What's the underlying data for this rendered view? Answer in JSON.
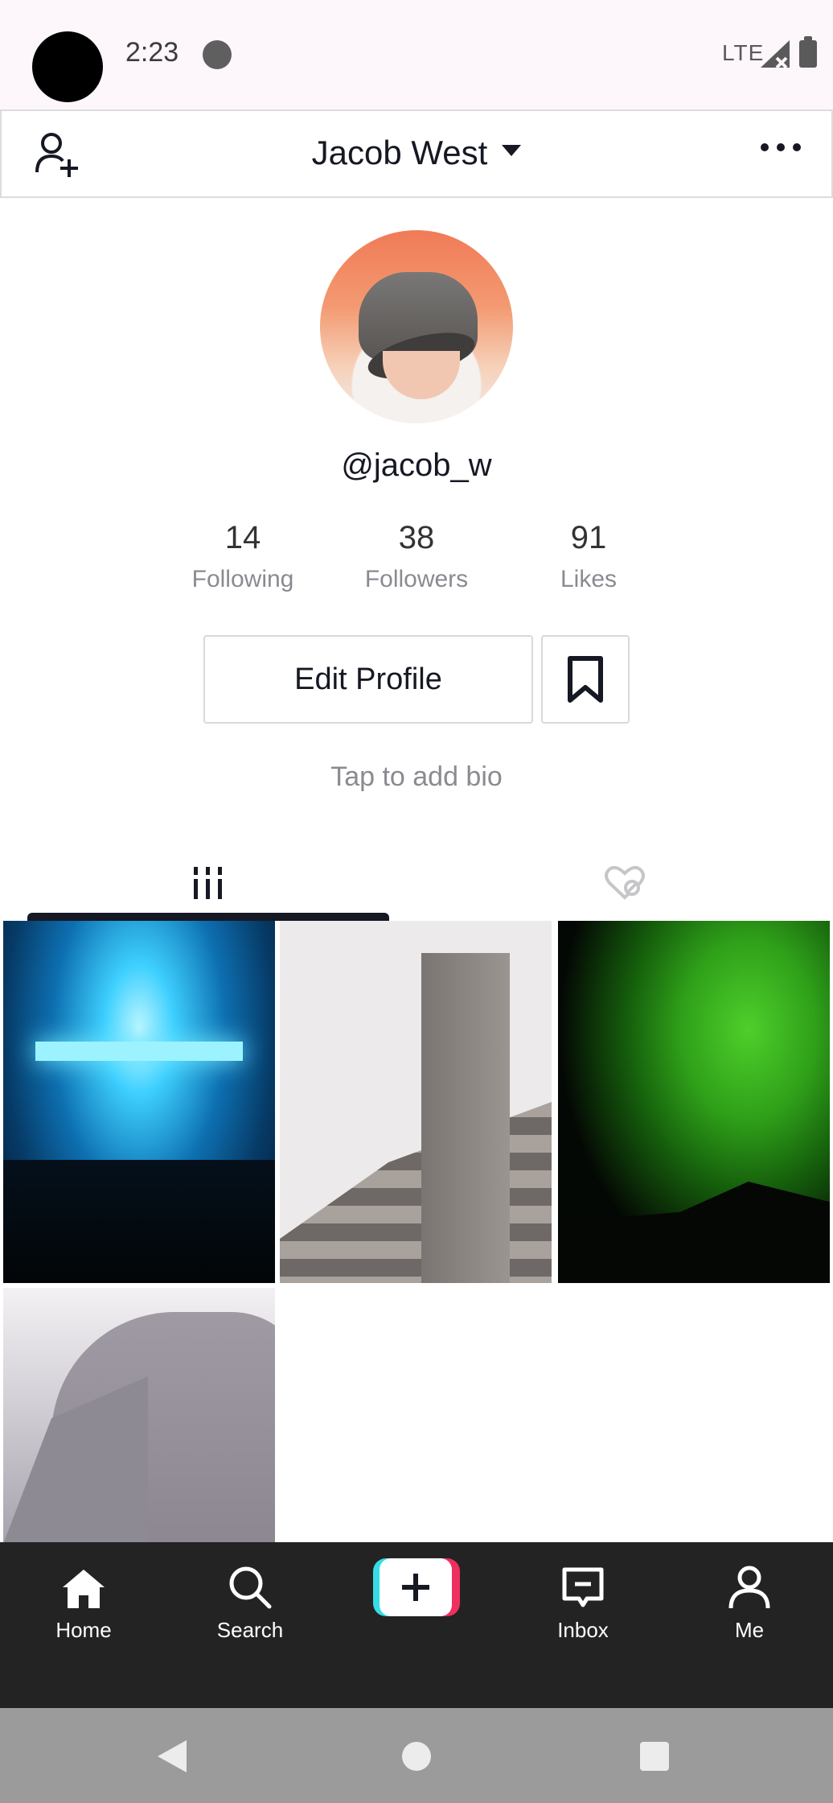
{
  "status_bar": {
    "time": "2:23",
    "network": "LTE",
    "icons": [
      "camera-cutout",
      "app-notification-icon",
      "signal-icon",
      "battery-icon"
    ]
  },
  "header": {
    "display_name": "Jacob West",
    "icons": [
      "add-user-icon",
      "caret-down-icon",
      "more-icon"
    ]
  },
  "profile": {
    "handle": "@jacob_w",
    "stats": [
      {
        "value": "14",
        "label": "Following"
      },
      {
        "value": "38",
        "label": "Followers"
      },
      {
        "value": "91",
        "label": "Likes"
      }
    ],
    "edit_label": "Edit Profile",
    "bio_placeholder": "Tap to add bio"
  },
  "tabs": {
    "active": "videos",
    "icons": [
      "videos-grid-icon",
      "liked-hidden-icon"
    ]
  },
  "videos": [
    {
      "id": "concert"
    },
    {
      "id": "building"
    },
    {
      "id": "aurora"
    },
    {
      "id": "mountain"
    }
  ],
  "bottom_nav": {
    "items": [
      {
        "label": "Home",
        "icon": "home-icon"
      },
      {
        "label": "Search",
        "icon": "search-icon"
      },
      {
        "label": "",
        "icon": "plus-icon"
      },
      {
        "label": "Inbox",
        "icon": "inbox-icon"
      },
      {
        "label": "Me",
        "icon": "profile-icon"
      }
    ]
  },
  "colors": {
    "nav_bg": "#232323",
    "create_cyan": "#35dde6",
    "create_red": "#ef2f5e",
    "text_primary": "#161823",
    "text_secondary": "#8a8b91"
  }
}
